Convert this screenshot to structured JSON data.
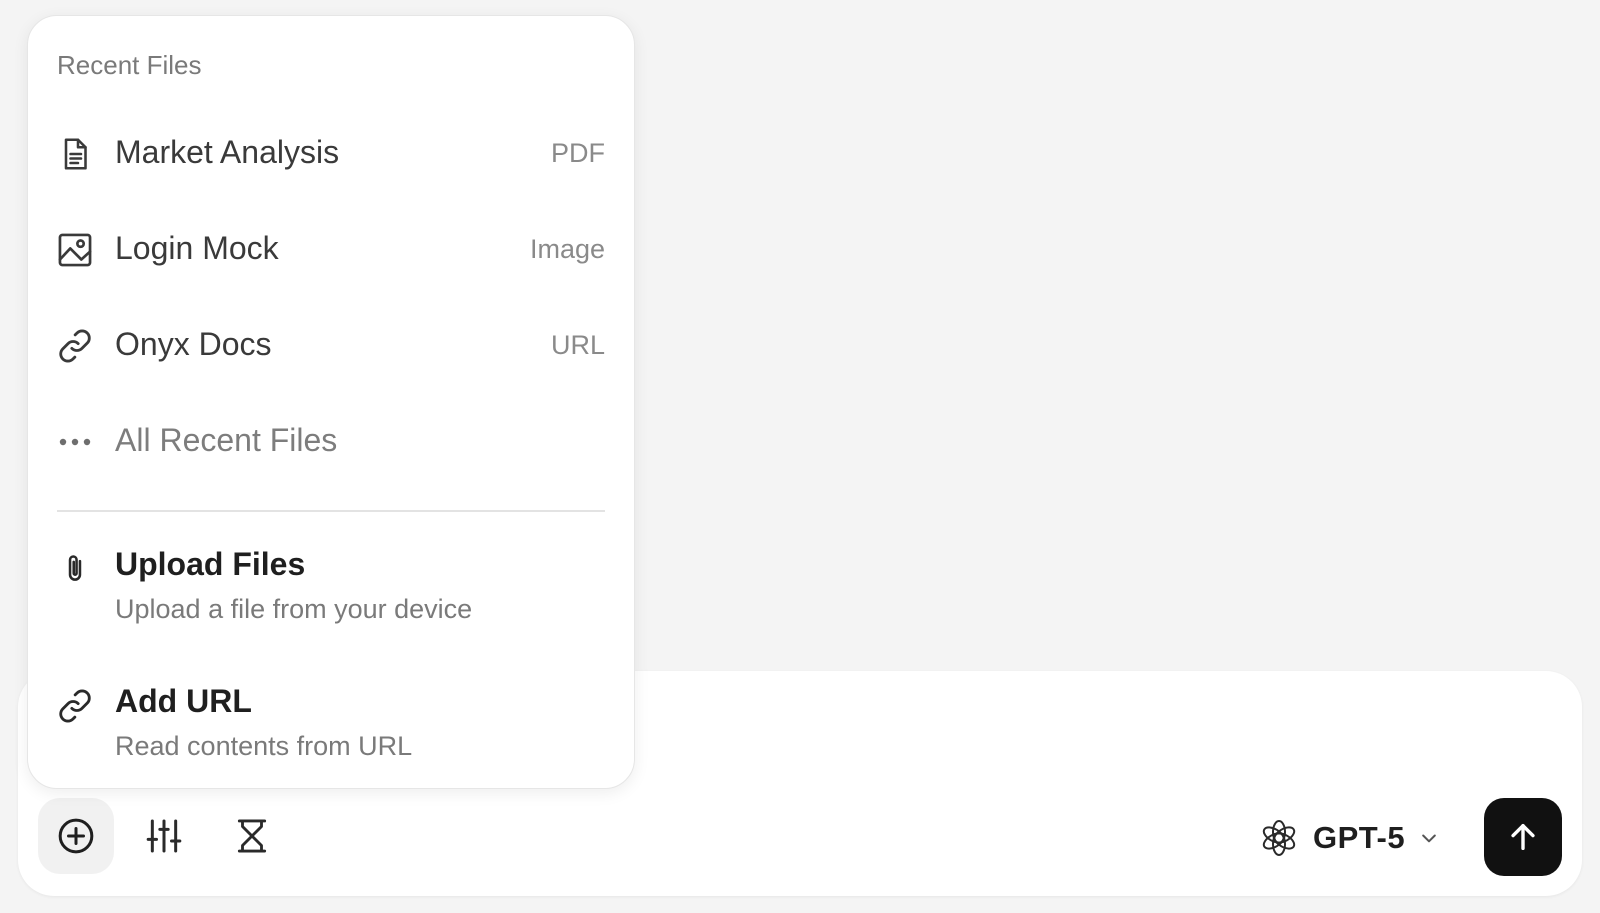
{
  "menu": {
    "section_title": "Recent Files",
    "recent_files": [
      {
        "name": "Market Analysis",
        "kind": "PDF",
        "icon": "document-icon"
      },
      {
        "name": "Login Mock",
        "kind": "Image",
        "icon": "image-icon"
      },
      {
        "name": "Onyx Docs",
        "kind": "URL",
        "icon": "link-icon"
      }
    ],
    "all_recent_label": "All Recent Files",
    "actions": [
      {
        "title": "Upload Files",
        "description": "Upload a file from your device",
        "icon": "paperclip-icon"
      },
      {
        "title": "Add URL",
        "description": "Read contents from URL",
        "icon": "link-icon"
      }
    ]
  },
  "composer": {
    "tools": [
      {
        "name": "add",
        "icon": "plus-circle-icon",
        "active": true
      },
      {
        "name": "settings",
        "icon": "sliders-icon",
        "active": false
      },
      {
        "name": "timer",
        "icon": "hourglass-icon",
        "active": false
      }
    ],
    "model": {
      "label": "GPT-5",
      "icon": "openai-logo-icon",
      "dropdown_icon": "chevron-down-icon"
    },
    "send_icon": "arrow-up-icon"
  },
  "colors": {
    "page_background": "#f4f4f4",
    "surface": "#ffffff",
    "send_button": "#111111",
    "muted_text": "#7a7a7a"
  }
}
